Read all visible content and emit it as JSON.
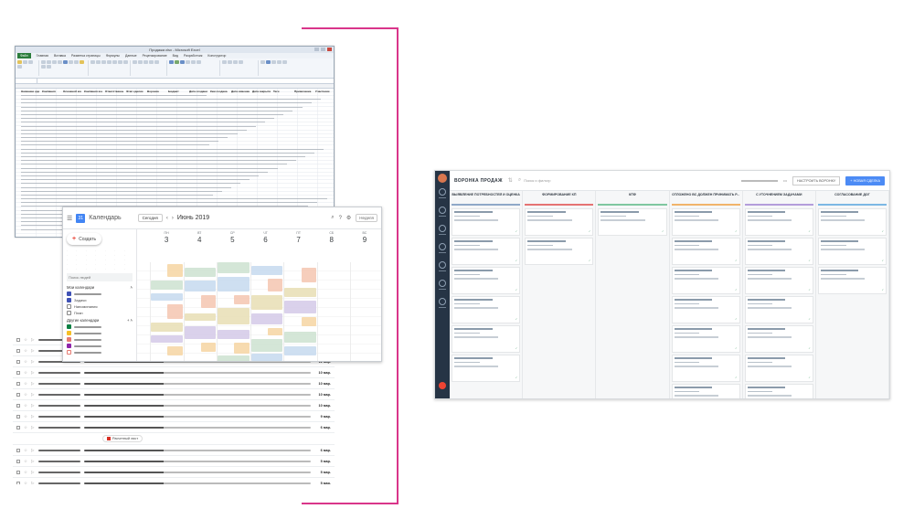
{
  "excel": {
    "title": "Продажи.xlsx - Microsoft Excel",
    "tabs": [
      "Файл",
      "Главная",
      "Вставка",
      "Разметка страницы",
      "Формулы",
      "Данные",
      "Рецензирование",
      "Вид",
      "Разработчик",
      "Конструктор"
    ],
    "columns": [
      "Название сделки",
      "Компания",
      "Основной контакт",
      "Компания контакта",
      "Ответственный",
      "Этап сделки",
      "Воронка",
      "Бюджет",
      "Дата создания",
      "Кем создана",
      "Дата изменения",
      "Дата закрытия",
      "Теги",
      "Примечание",
      "Участники"
    ]
  },
  "calendar": {
    "app_name": "Календарь",
    "today_button": "Сегодня",
    "month_label": "Июнь 2019",
    "view_label": "Неделя",
    "create_button": "Создать",
    "search_people": "Поиск людей",
    "my_calendars": "Мои календари",
    "other_calendars": "Другие календари",
    "my_calendar_items": [
      "",
      "Задачи",
      "Напоминания",
      "План"
    ],
    "days": [
      {
        "dow": "ПН",
        "num": "3"
      },
      {
        "dow": "ВТ",
        "num": "4"
      },
      {
        "dow": "СР",
        "num": "5"
      },
      {
        "dow": "ЧТ",
        "num": "6"
      },
      {
        "dow": "ПТ",
        "num": "7"
      },
      {
        "dow": "СБ",
        "num": "8"
      },
      {
        "dow": "ВС",
        "num": "9"
      }
    ]
  },
  "gmail": {
    "dates": [
      "11 мар.",
      "11 мар.",
      "11 мар.",
      "10 мар.",
      "10 мар.",
      "10 мар.",
      "10 мар.",
      "9 мар.",
      "6 мар.",
      "6 мар.",
      "5 мар.",
      "5 мар.",
      "5 мар."
    ],
    "attachment_label": "Расчетный лист"
  },
  "crm": {
    "title": "ВОРОНКА ПРОДАЖ",
    "search_placeholder": "Поиск и фильтр",
    "settings_button": "НАСТРОИТЬ ВОРОНКУ",
    "new_button": "+ НОВАЯ СДЕЛКА",
    "columns": [
      {
        "title": "ВЫЯВЛЕНИЕ ПОТРЕБНОСТЕЙ И ОЦЕНКА",
        "color": "#8fa8c8",
        "cards": 6
      },
      {
        "title": "ФОРМИРОВАНИЕ КП",
        "color": "#e57373",
        "cards": 2
      },
      {
        "title": "КПФ",
        "color": "#7fc7a0",
        "cards": 1
      },
      {
        "title": "ОТЛОЖЕНО ВС ДОЛЖЕН ПРИНИМАТЬ Р...",
        "color": "#f1b46a",
        "cards": 7
      },
      {
        "title": "С УТОЧНЕНИЕМ ЗАДАЧАМИ",
        "color": "#b49ddb",
        "cards": 7
      },
      {
        "title": "СОГЛАСОВАНИЕ ДОГ",
        "color": "#7cb8e4",
        "cards": 3
      }
    ]
  }
}
